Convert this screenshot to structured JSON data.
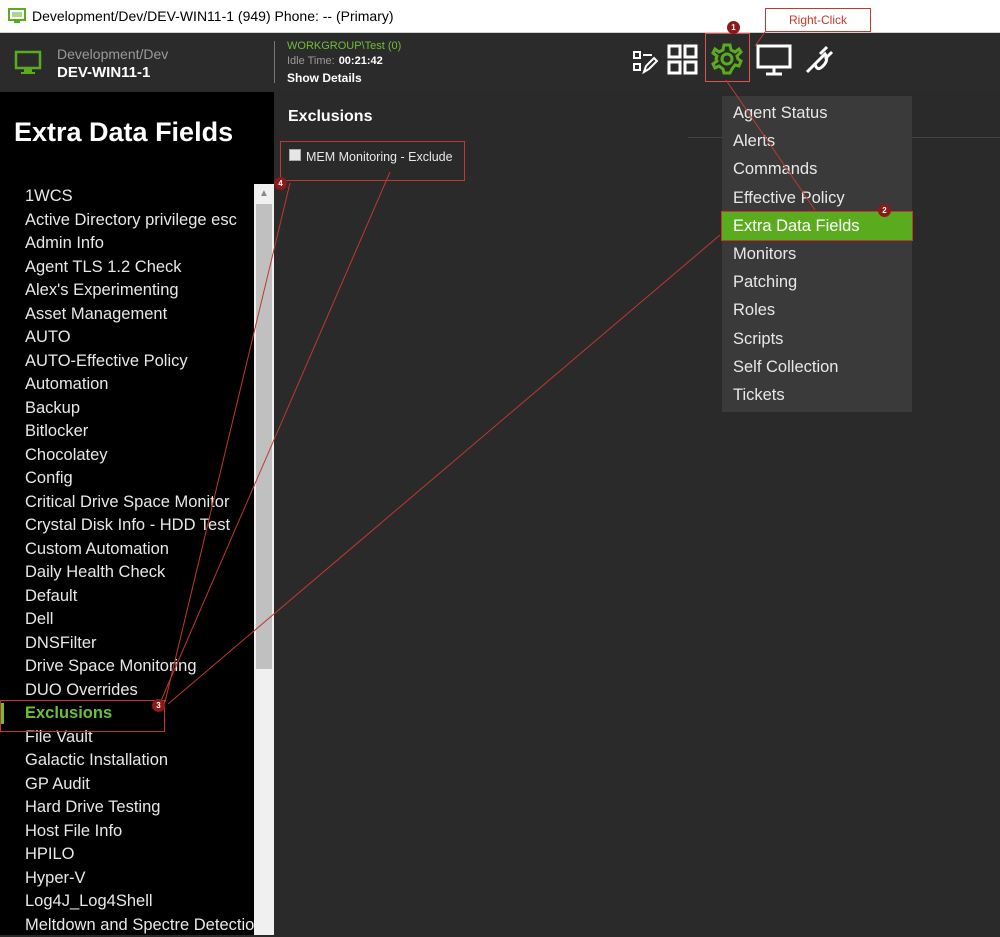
{
  "window": {
    "title": "Development/Dev/DEV-WIN11-1 (949) Phone: -- (Primary)"
  },
  "header": {
    "path": "Development/Dev",
    "computer_name": "DEV-WIN11-1",
    "workgroup": "WORKGROUP\\Test (0)",
    "idle_label": "Idle Time:",
    "idle_value": "00:21:42",
    "show_details": "Show Details",
    "toolbar_icons": [
      "edit-icon",
      "grid-icon",
      "gear-icon",
      "monitor-icon",
      "plug-icon"
    ]
  },
  "annotation": {
    "callout": "Right-Click",
    "badges": [
      "1",
      "2",
      "3",
      "4"
    ]
  },
  "sidebar": {
    "title": "Extra Data Fields",
    "items": [
      "1WCS",
      "Active Directory privilege esc",
      "Admin Info",
      "Agent TLS 1.2 Check",
      "Alex's Experimenting",
      "Asset Management",
      "AUTO",
      "AUTO-Effective Policy",
      "Automation",
      "Backup",
      "Bitlocker",
      "Chocolatey",
      "Config",
      "Critical Drive Space Monitor",
      "Crystal Disk Info - HDD Test",
      "Custom Automation",
      "Daily Health Check",
      "Default",
      "Dell",
      "DNSFilter",
      "Drive Space Monitoring",
      "DUO Overrides",
      "Exclusions",
      "File Vault",
      "Galactic Installation",
      "GP Audit",
      "Hard Drive Testing",
      "Host File Info",
      "HPILO",
      "Hyper-V",
      "Log4J_Log4Shell",
      "Meltdown and Spectre Detection"
    ],
    "active_item": "Exclusions"
  },
  "main": {
    "title": "Exclusions",
    "fields": [
      {
        "label": "MEM Monitoring - Exclude",
        "checked": false
      }
    ]
  },
  "context_menu": {
    "items": [
      "Agent Status",
      "Alerts",
      "Commands",
      "Effective Policy",
      "Extra Data Fields",
      "Monitors",
      "Patching",
      "Roles",
      "Scripts",
      "Self Collection",
      "Tickets"
    ],
    "active_item": "Extra Data Fields"
  },
  "colors": {
    "accent": "#6cbf3a",
    "annotation": "#c0392b"
  }
}
